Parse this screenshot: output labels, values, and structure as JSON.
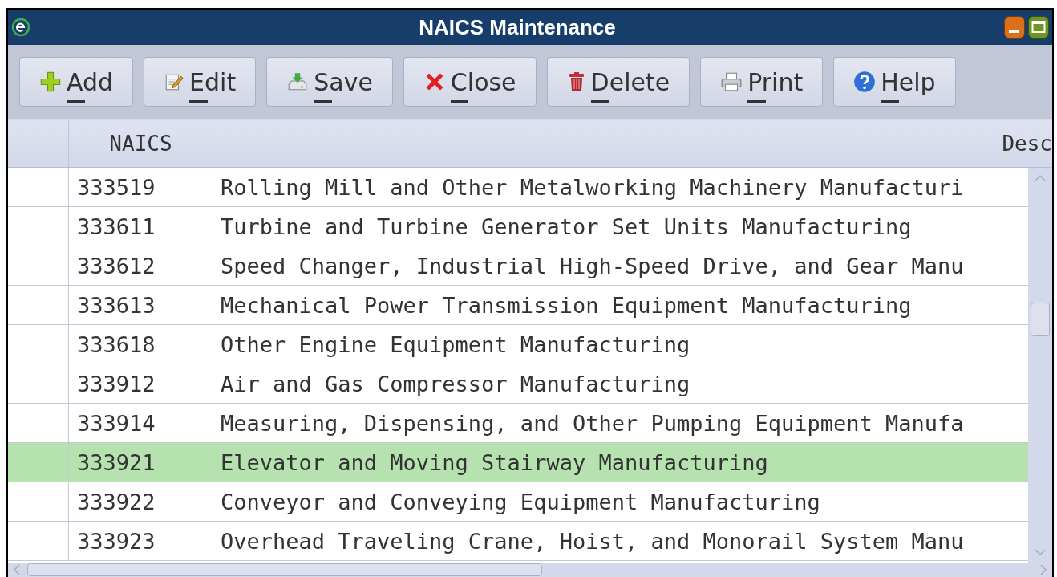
{
  "window": {
    "title": "NAICS Maintenance"
  },
  "toolbar": [
    {
      "label": "Add",
      "kind": "add"
    },
    {
      "label": "Edit",
      "kind": "edit"
    },
    {
      "label": "Save",
      "kind": "save"
    },
    {
      "label": "Close",
      "kind": "close"
    },
    {
      "label": "Delete",
      "kind": "delete"
    },
    {
      "label": "Print",
      "kind": "print"
    },
    {
      "label": "Help",
      "kind": "help"
    }
  ],
  "table": {
    "columns": [
      "NAICS",
      "Desc"
    ],
    "rows": [
      {
        "naics": "333519",
        "description": "Rolling Mill and Other Metalworking Machinery Manufacturi",
        "selected": false
      },
      {
        "naics": "333611",
        "description": "Turbine and Turbine Generator Set Units Manufacturing",
        "selected": false
      },
      {
        "naics": "333612",
        "description": "Speed Changer, Industrial High-Speed Drive, and Gear Manu",
        "selected": false
      },
      {
        "naics": "333613",
        "description": "Mechanical Power Transmission Equipment Manufacturing",
        "selected": false
      },
      {
        "naics": "333618",
        "description": "Other Engine Equipment Manufacturing",
        "selected": false
      },
      {
        "naics": "333912",
        "description": "Air and Gas Compressor Manufacturing",
        "selected": false
      },
      {
        "naics": "333914",
        "description": "Measuring, Dispensing, and Other Pumping Equipment Manufa",
        "selected": false
      },
      {
        "naics": "333921",
        "description": "Elevator and Moving Stairway Manufacturing",
        "selected": true
      },
      {
        "naics": "333922",
        "description": "Conveyor and Conveying Equipment Manufacturing",
        "selected": false
      },
      {
        "naics": "333923",
        "description": "Overhead Traveling Crane, Hoist, and Monorail System Manu",
        "selected": false
      }
    ]
  }
}
